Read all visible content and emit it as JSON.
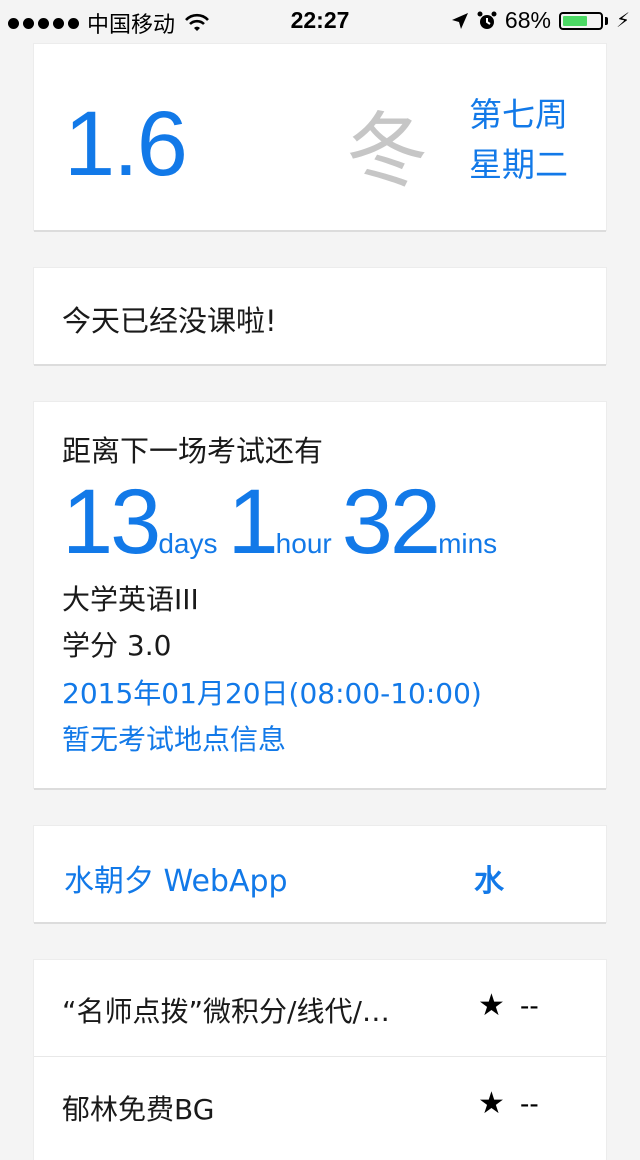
{
  "status_bar": {
    "carrier": "中国移动",
    "time": "22:27",
    "battery_percent": "68%",
    "battery_level": 0.68,
    "battery_color": "#4cd964"
  },
  "date_card": {
    "date": "1.6",
    "season": "冬",
    "week": "第七周",
    "weekday": "星期二"
  },
  "today_card": {
    "message": "今天已经没课啦!"
  },
  "exam_card": {
    "label": "距离下一场考试还有",
    "days_value": "13",
    "days_unit": "days",
    "hours_value": "1",
    "hours_unit": "hour",
    "mins_value": "32",
    "mins_unit": "mins",
    "course": "大学英语III",
    "credit": "学分 3.0",
    "time": "2015年01月20日(08:00-10:00)",
    "place": "暂无考试地点信息"
  },
  "app_card": {
    "link_label": "水朝夕 WebApp",
    "icon_char": "水"
  },
  "courses": [
    {
      "title": "“名师点拨”微积分/线代/…",
      "star": "★",
      "score": "--"
    },
    {
      "title": "郁林免费BG",
      "star": "★",
      "score": "--"
    }
  ],
  "colors": {
    "accent": "#1279e8",
    "season_gray": "#c6c6c6",
    "background": "#f4f4f4"
  }
}
